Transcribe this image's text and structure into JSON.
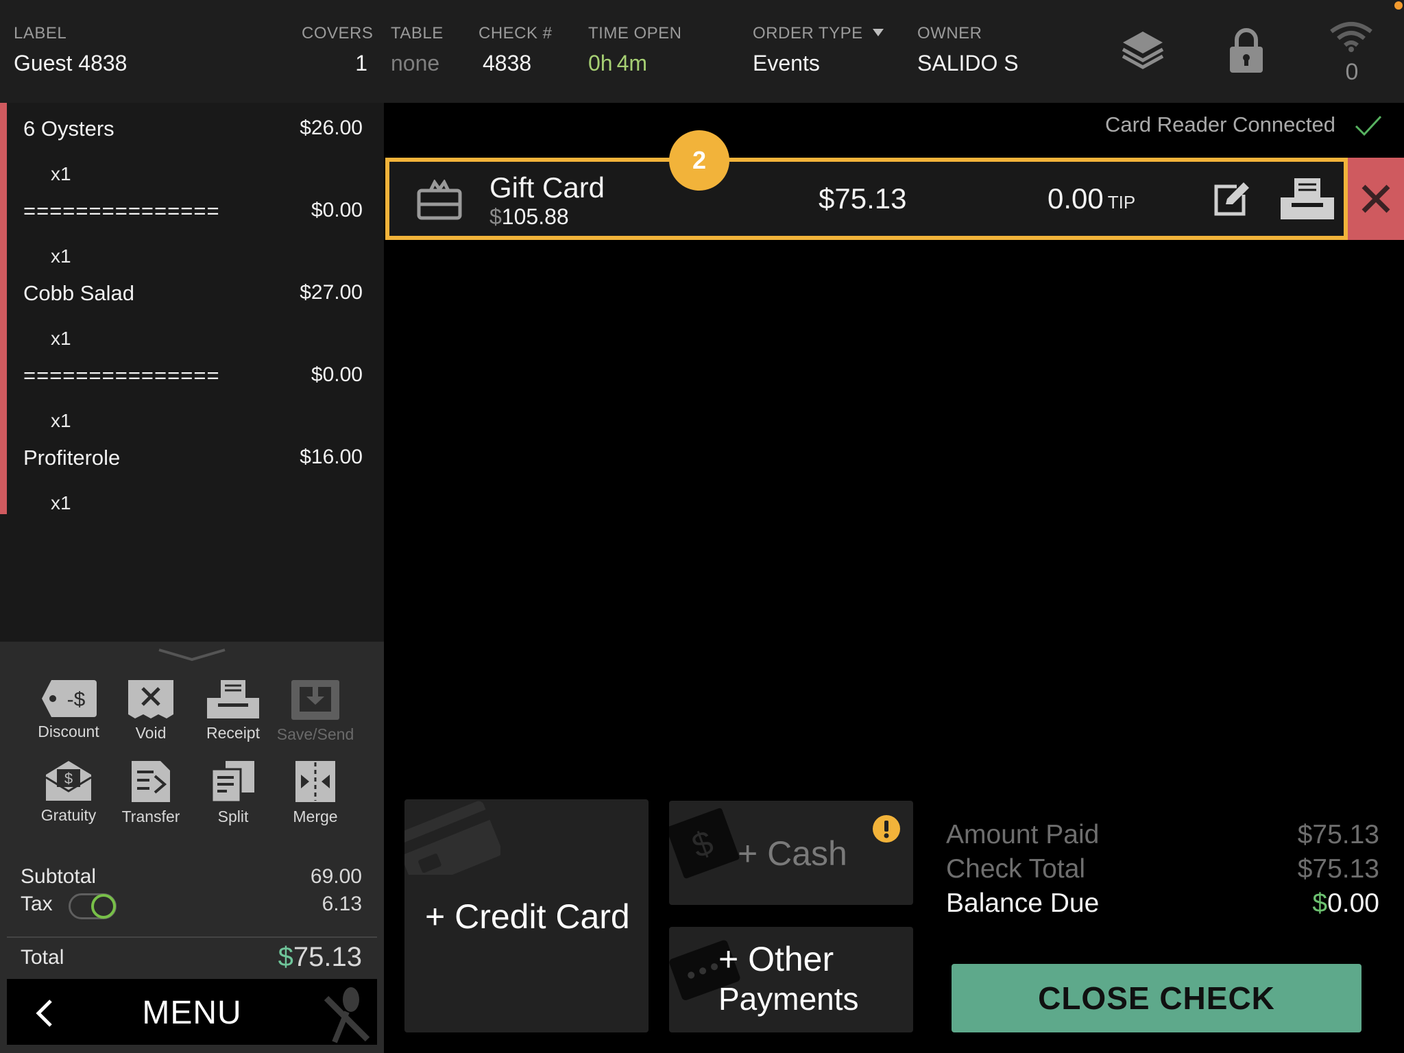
{
  "header": {
    "label": {
      "title": "LABEL",
      "value": "Guest 4838"
    },
    "covers": {
      "title": "COVERS",
      "value": "1"
    },
    "table": {
      "title": "TABLE",
      "value": "none"
    },
    "check": {
      "title": "CHECK #",
      "value": "4838"
    },
    "time_open": {
      "title": "TIME OPEN",
      "h_num": "0",
      "h_unit": "h",
      "m_num": "4",
      "m_unit": "m"
    },
    "order_type": {
      "title": "ORDER TYPE",
      "value": "Events"
    },
    "owner": {
      "title": "OWNER",
      "value": "SALIDO S"
    },
    "icons": [
      "layers-icon",
      "lock-icon",
      "wifi-icon"
    ],
    "wifi_count": "0"
  },
  "order_items": [
    {
      "name": "6 Oysters",
      "price": "$26.00",
      "qty": "x1"
    },
    {
      "name": "===============",
      "price": "$0.00",
      "qty": "x1"
    },
    {
      "name": "Cobb Salad",
      "price": "$27.00",
      "qty": "x1"
    },
    {
      "name": "===============",
      "price": "$0.00",
      "qty": "x1"
    },
    {
      "name": "Profiterole",
      "price": "$16.00",
      "qty": "x1"
    }
  ],
  "actions": [
    {
      "label": "Discount",
      "icon": "discount-tag-icon",
      "enabled": true
    },
    {
      "label": "Void",
      "icon": "void-receipt-icon",
      "enabled": true
    },
    {
      "label": "Receipt",
      "icon": "printer-icon",
      "enabled": true
    },
    {
      "label": "Save/Send",
      "icon": "save-send-icon",
      "enabled": false
    },
    {
      "label": "Gratuity",
      "icon": "gratuity-envelope-icon",
      "enabled": true
    },
    {
      "label": "Transfer",
      "icon": "transfer-icon",
      "enabled": true
    },
    {
      "label": "Split",
      "icon": "split-icon",
      "enabled": true
    },
    {
      "label": "Merge",
      "icon": "merge-icon",
      "enabled": true
    }
  ],
  "totals": {
    "subtotal_label": "Subtotal",
    "subtotal": "69.00",
    "tax_label": "Tax",
    "tax": "6.13",
    "tax_enabled": true,
    "total_label": "Total",
    "total_currency": "$",
    "total": "75.13"
  },
  "menu_bar": {
    "label": "MENU"
  },
  "reader_status": "Card Reader Connected",
  "payment": {
    "title": "Gift Card",
    "balance_currency": "$",
    "balance": "105.88",
    "amount": "$75.13",
    "tip": "0.00",
    "tip_label": "TIP",
    "badge": "2"
  },
  "payment_buttons": {
    "credit_card": "+ Credit Card",
    "cash": "+ Cash",
    "other_line1": "+ Other",
    "other_line2": "Payments"
  },
  "summary": {
    "amount_paid_label": "Amount Paid",
    "amount_paid": "$75.13",
    "check_total_label": "Check Total",
    "check_total": "$75.13",
    "balance_due_label": "Balance Due",
    "balance_due_currency": "$",
    "balance_due": "0.00"
  },
  "close_check": "CLOSE CHECK",
  "colors": {
    "accent_yellow": "#f2b33a",
    "remove_red": "#cf5a5f",
    "close_green": "#5ea98b",
    "status_green": "#6cc070"
  }
}
